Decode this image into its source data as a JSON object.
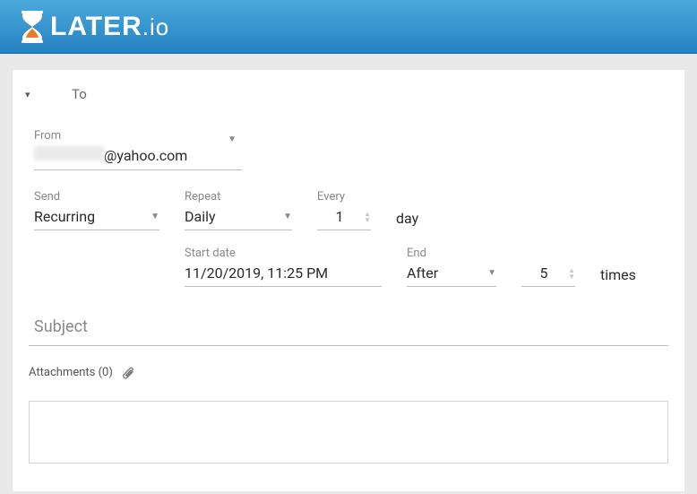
{
  "brand": {
    "later": "LATER",
    "io": ".io"
  },
  "to_label": "To",
  "from": {
    "label": "From",
    "domain": "@yahoo.com"
  },
  "send": {
    "label": "Send",
    "value": "Recurring"
  },
  "repeat": {
    "label": "Repeat",
    "value": "Daily"
  },
  "every": {
    "label": "Every",
    "value": "1",
    "unit": "day"
  },
  "start": {
    "label": "Start date",
    "value": "11/20/2019, 11:25 PM"
  },
  "end": {
    "label": "End",
    "value": "After",
    "count": "5",
    "unit": "times"
  },
  "subject_placeholder": "Subject",
  "attachments": {
    "label": "Attachments (0)"
  }
}
